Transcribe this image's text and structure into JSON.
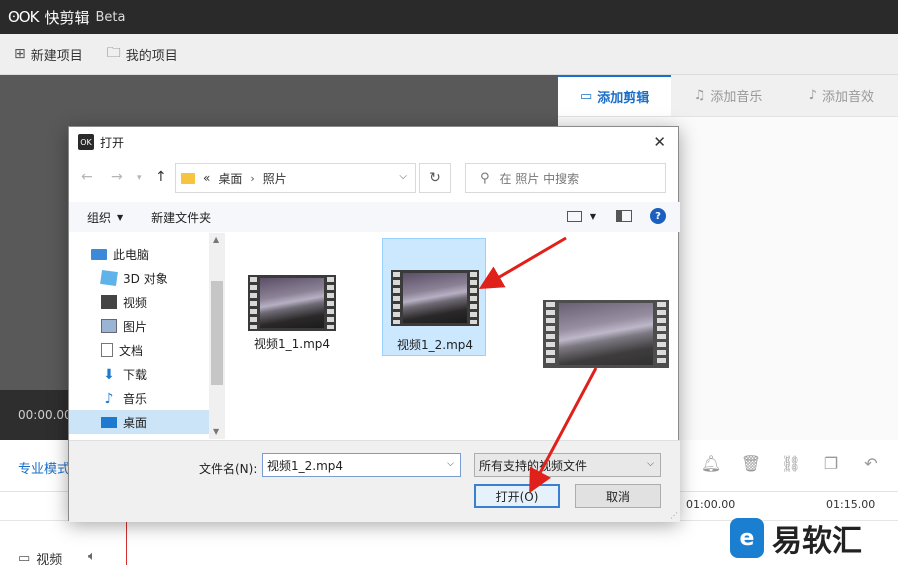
{
  "app": {
    "logo": "ʘOK",
    "title": "快剪辑",
    "beta": "Beta",
    "menu": [
      {
        "label": "新建项目",
        "icon": "plus-box-icon"
      },
      {
        "label": "我的项目",
        "icon": "folder-icon"
      }
    ],
    "timecode": "00:00.00",
    "media_tabs": [
      {
        "label": "添加剪辑",
        "icon": "video-camera-icon",
        "active": true
      },
      {
        "label": "添加音乐",
        "icon": "music-icon",
        "active": false
      },
      {
        "label": "添加音效",
        "icon": "sound-effect-icon",
        "active": false
      }
    ],
    "pro_mode": "专业模式",
    "timeline": {
      "mark1": "01:00.00",
      "mark2": "01:15.00"
    },
    "track_label": "视频"
  },
  "dialog": {
    "title": "打开",
    "breadcrumb": {
      "prefix": "«",
      "items": [
        "桌面",
        "照片"
      ]
    },
    "search_placeholder": "在 照片 中搜索",
    "toolbar": {
      "organize": "组织",
      "new_folder": "新建文件夹"
    },
    "nav_items": [
      {
        "label": "此电脑",
        "icon": "computer-icon"
      },
      {
        "label": "3D 对象",
        "icon": "3d-objects-icon"
      },
      {
        "label": "视频",
        "icon": "video-folder-icon"
      },
      {
        "label": "图片",
        "icon": "pictures-folder-icon"
      },
      {
        "label": "文档",
        "icon": "documents-folder-icon"
      },
      {
        "label": "下载",
        "icon": "downloads-folder-icon"
      },
      {
        "label": "音乐",
        "icon": "music-folder-icon"
      },
      {
        "label": "桌面",
        "icon": "desktop-folder-icon",
        "selected": true
      }
    ],
    "files": [
      {
        "name": "视频1_1.mp4",
        "selected": false
      },
      {
        "name": "视频1_2.mp4",
        "selected": true
      }
    ],
    "filename_label": "文件名(N):",
    "filename_value": "视频1_2.mp4",
    "filter_value": "所有支持的视频文件",
    "open_button": "打开(O)",
    "cancel_button": "取消"
  },
  "watermark": {
    "logo": "e",
    "text": "易软汇"
  },
  "colors": {
    "accent": "#1b6fc9",
    "arrow": "#e0201b",
    "selection": "#cce8ff"
  }
}
